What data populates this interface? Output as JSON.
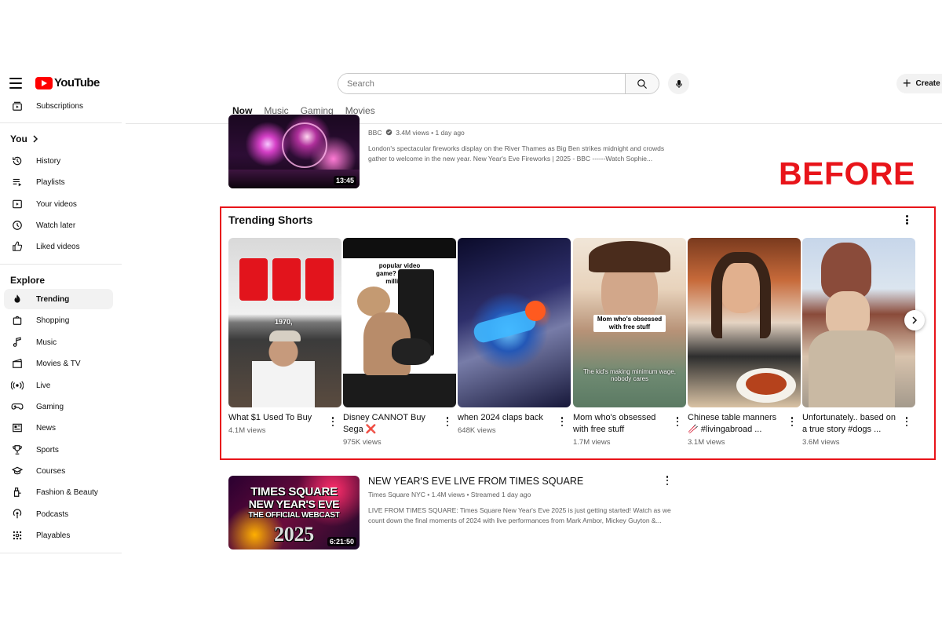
{
  "header": {
    "logo_text": "YouTube",
    "search_placeholder": "Search",
    "create_label": "Create"
  },
  "tabs": [
    {
      "label": "Now",
      "active": true
    },
    {
      "label": "Music",
      "active": false
    },
    {
      "label": "Gaming",
      "active": false
    },
    {
      "label": "Movies",
      "active": false
    }
  ],
  "sidebar": {
    "subscriptions": "Subscriptions",
    "you_heading": "You",
    "you_items": [
      {
        "label": "History",
        "icon": "history-icon"
      },
      {
        "label": "Playlists",
        "icon": "playlists-icon"
      },
      {
        "label": "Your videos",
        "icon": "your-videos-icon"
      },
      {
        "label": "Watch later",
        "icon": "watch-later-icon"
      },
      {
        "label": "Liked videos",
        "icon": "liked-videos-icon"
      }
    ],
    "explore_heading": "Explore",
    "explore_items": [
      {
        "label": "Trending",
        "icon": "trending-icon",
        "active": true
      },
      {
        "label": "Shopping",
        "icon": "shopping-icon"
      },
      {
        "label": "Music",
        "icon": "music-icon"
      },
      {
        "label": "Movies & TV",
        "icon": "movies-icon"
      },
      {
        "label": "Live",
        "icon": "live-icon"
      },
      {
        "label": "Gaming",
        "icon": "gaming-icon"
      },
      {
        "label": "News",
        "icon": "news-icon"
      },
      {
        "label": "Sports",
        "icon": "sports-icon"
      },
      {
        "label": "Courses",
        "icon": "courses-icon"
      },
      {
        "label": "Fashion & Beauty",
        "icon": "fashion-icon"
      },
      {
        "label": "Podcasts",
        "icon": "podcasts-icon"
      },
      {
        "label": "Playables",
        "icon": "playables-icon"
      }
    ]
  },
  "videos": {
    "top": {
      "channel": "BBC",
      "meta": "3.4M views • 1 day ago",
      "description": "London's spectacular fireworks display on the River Thames as Big Ben strikes midnight and crowds gather to welcome in the new year. New Year's Eve Fireworks | 2025 - BBC ------Watch Sophie...",
      "duration": "13:45"
    },
    "bottom": {
      "title": "NEW YEAR'S EVE LIVE FROM TIMES SQUARE",
      "meta": "Times Square NYC • 1.4M views • Streamed 1 day ago",
      "description": "LIVE FROM TIMES SQUARE: Times Square New Year's Eve 2025 is just getting started! Watch as we count down the final moments of 2024 with live performances from Mark Ambor, Mickey Guyton &...",
      "duration": "6:21:50",
      "thumb_lines": [
        "TIMES SQUARE",
        "NEW YEAR'S EVE",
        "THE OFFICIAL WEBCAST",
        "2025"
      ]
    }
  },
  "trending": {
    "annotation": "BEFORE",
    "title": "Trending Shorts",
    "shorts": [
      {
        "title": "What $1 Used To Buy",
        "views": "4.1M views",
        "overlay": "1970,"
      },
      {
        "title": "Disney CANNOT Buy Sega ❌",
        "views": "975K views",
        "overlay": "popular video game? cost 390 million to"
      },
      {
        "title": "when 2024 claps back",
        "views": "648K views"
      },
      {
        "title": "Mom who's obsessed with free stuff",
        "views": "1.7M views",
        "overlay": "Mom who's obsessed with free stuff",
        "overlay2": "The kid's making minimum wage, nobody cares"
      },
      {
        "title": "Chinese table manners 🥢 #livingabroad ...",
        "views": "3.1M views"
      },
      {
        "title": "Unfortunately.. based on a true story #dogs ...",
        "views": "3.6M views"
      }
    ]
  },
  "colors": {
    "brand_red": "#ff0000",
    "annotation_red": "#e8141a",
    "text_primary": "#0f0f0f",
    "text_secondary": "#606060"
  }
}
